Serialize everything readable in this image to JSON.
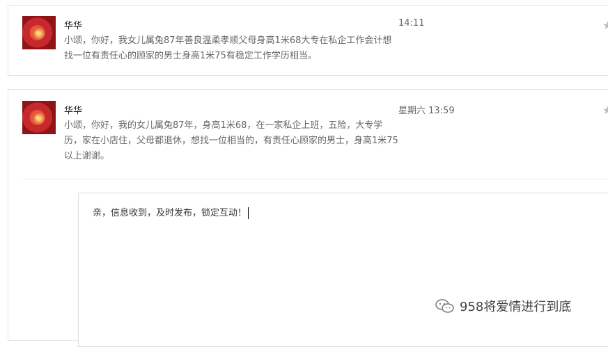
{
  "messages": [
    {
      "name": "华华",
      "time": "14:11",
      "text": "小颂，你好，我女儿属兔87年善良温柔孝顺父母身高1米68大专在私企工作会计想找一位有责任心的顾家的男士身高1米75有稳定工作学历相当。"
    },
    {
      "name": "华华",
      "time": "星期六 13:59",
      "text": "小颂，你好，我的女儿属兔87年，身高1米68，在一家私企上班，五险，大专学历，家在小店住，父母都退休，想找一位相当的，有责任心顾家的男士，身高1米75以上谢谢。"
    }
  ],
  "reply": {
    "text": "亲，信息收到，及时发布，锁定互动！"
  },
  "watermark": {
    "text": "958将爱情进行到底"
  },
  "icons": {
    "star": "star-icon",
    "avatar": "flower-avatar",
    "watermark": "wechat-icon"
  }
}
